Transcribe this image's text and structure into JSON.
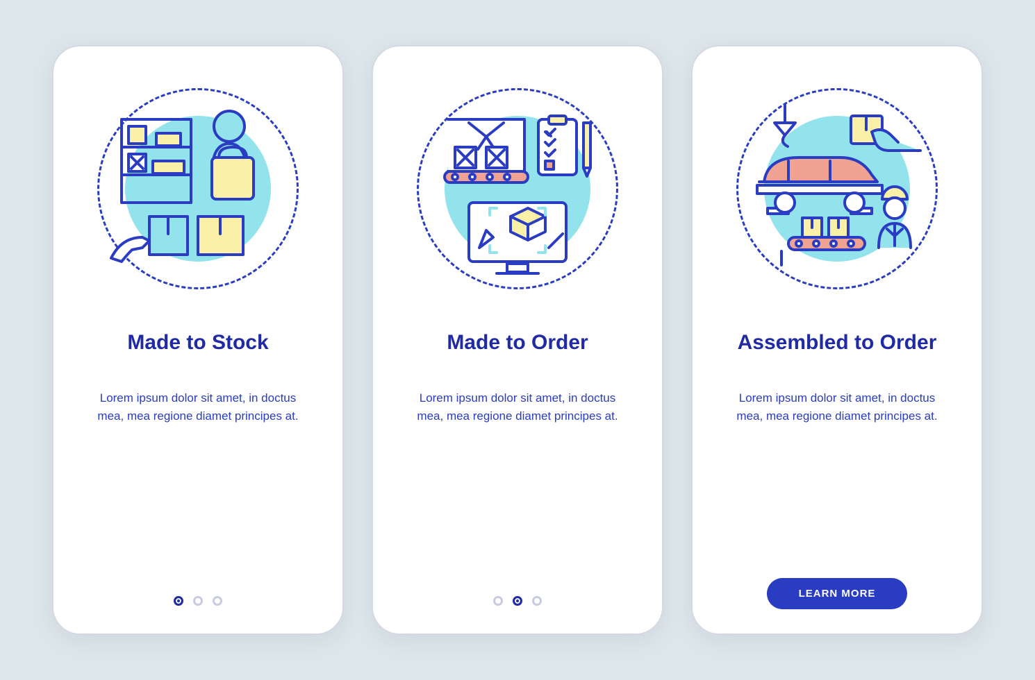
{
  "colors": {
    "primary": "#2a3cc1",
    "accent_cyan": "#92e3ec",
    "accent_yellow": "#faf0a8",
    "accent_coral": "#f0a393",
    "background": "#dde6ea"
  },
  "cards": [
    {
      "title": "Made to Stock",
      "body": "Lorem ipsum dolor sit amet, in doctus mea, mea regione diamet principes at.",
      "icon": "stock-shelf-icon",
      "active_dot": 0,
      "has_button": false
    },
    {
      "title": "Made to Order",
      "body": "Lorem ipsum dolor sit amet, in doctus mea, mea regione diamet principes at.",
      "icon": "factory-computer-icon",
      "active_dot": 1,
      "has_button": false
    },
    {
      "title": "Assembled to Order",
      "body": "Lorem ipsum dolor sit amet, in doctus mea, mea regione diamet principes at.",
      "icon": "car-assembly-icon",
      "active_dot": 2,
      "has_button": true
    }
  ],
  "button_label": "LEARN MORE",
  "dot_count": 3
}
